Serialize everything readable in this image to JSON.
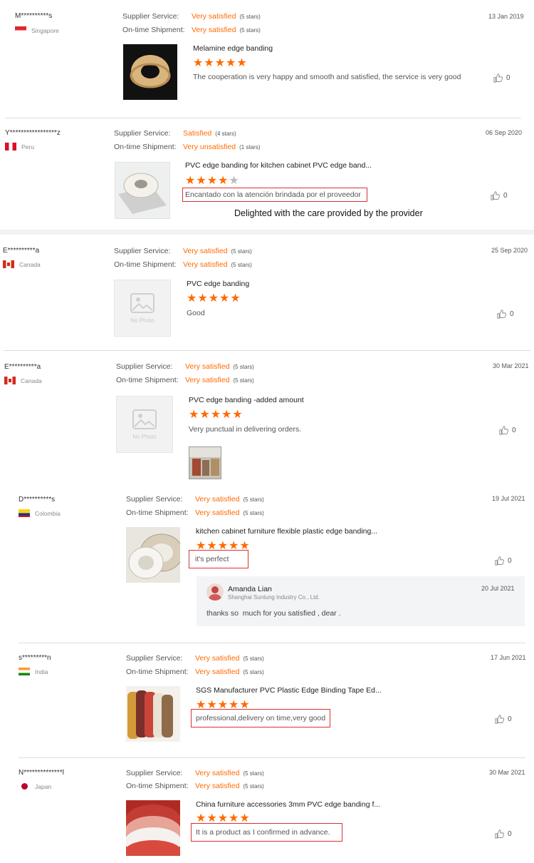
{
  "labels": {
    "supplier_service": "Supplier Service:",
    "ontime_shipment": "On-time Shipment:"
  },
  "reviews": [
    {
      "user": "M**********s",
      "country": "Singapore",
      "date": "13 Jan 2019",
      "supplier_service": "Very satisfied",
      "supplier_count": "(5 stars)",
      "ontime": "Very satisfied",
      "ontime_count": "(5 stars)",
      "product": "Melamine edge banding",
      "stars": 5,
      "comment": "The cooperation is very happy and smooth and satisfied, the service is very good",
      "likes": "0"
    },
    {
      "user": "Y*****************z",
      "country": "Peru",
      "date": "06 Sep 2020",
      "supplier_service": "Satisfied",
      "supplier_count": "(4 stars)",
      "ontime": "Very unsatisfied",
      "ontime_count": "(1 stars)",
      "product": "PVC edge banding for kitchen cabinet PVC edge band...",
      "stars": 4,
      "comment": "Encantado con la atención brindada por el proveedor",
      "translation": "Delighted with the care provided by the provider",
      "likes": "0"
    },
    {
      "user": "E**********a",
      "country": "Canada",
      "date": "25 Sep 2020",
      "supplier_service": "Very satisfied",
      "supplier_count": "(5 stars)",
      "ontime": "Very satisfied",
      "ontime_count": "(5 stars)",
      "product": "PVC edge banding",
      "stars": 5,
      "comment": "Good",
      "nophoto": "No Photo",
      "likes": "0"
    },
    {
      "user": "E**********a",
      "country": "Canada",
      "date": "30 Mar 2021",
      "supplier_service": "Very satisfied",
      "supplier_count": "(5 stars)",
      "ontime": "Very satisfied",
      "ontime_count": "(5 stars)",
      "product": "PVC edge banding -added amount",
      "stars": 5,
      "comment": "Very punctual in delivering orders.",
      "nophoto": "No Photo",
      "likes": "0"
    },
    {
      "user": "D**********s",
      "country": "Colombia",
      "date": "19 Jul 2021",
      "supplier_service": "Very satisfied",
      "supplier_count": "(5 stars)",
      "ontime": "Very satisfied",
      "ontime_count": "(5 stars)",
      "product": "kitchen cabinet furniture flexible plastic edge banding...",
      "stars": 5,
      "comment": "it's perfect",
      "likes": "0",
      "reply": {
        "name": "Amanda Lian",
        "company": "Shanghai Suntung Industry Co., Ltd.",
        "date": "20 Jul 2021",
        "text": "thanks so  much for you satisfied , dear ."
      }
    },
    {
      "user": "s*********n",
      "country": "India",
      "date": "17 Jun 2021",
      "supplier_service": "Very satisfied",
      "supplier_count": "(5 stars)",
      "ontime": "Very satisfied",
      "ontime_count": "(5 stars)",
      "product": "SGS Manufacturer PVC Plastic Edge Binding Tape Ed...",
      "stars": 5,
      "comment": "professional,delivery on time,very good",
      "likes": "0"
    },
    {
      "user": "N**************l",
      "country": "Japan",
      "date": "30 Mar 2021",
      "supplier_service": "Very satisfied",
      "supplier_count": "(5 stars)",
      "ontime": "Very satisfied",
      "ontime_count": "(5 stars)",
      "product": "China furniture accessories 3mm PVC edge banding f...",
      "stars": 5,
      "comment": "It is a product as I confirmed in advance.",
      "likes": "0"
    }
  ]
}
